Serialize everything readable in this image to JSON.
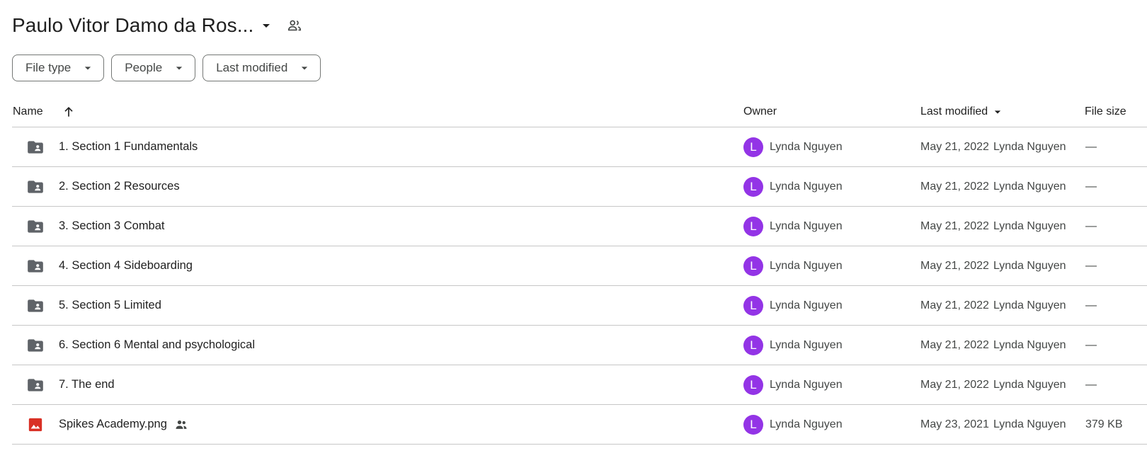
{
  "header": {
    "title": "Paulo Vitor Damo da Ros..."
  },
  "filters": [
    {
      "label": "File type"
    },
    {
      "label": "People"
    },
    {
      "label": "Last modified"
    }
  ],
  "columns": {
    "name": "Name",
    "owner": "Owner",
    "last_modified": "Last modified",
    "file_size": "File size"
  },
  "rows": [
    {
      "type": "folder",
      "name": "1. Section 1 Fundamentals",
      "owner_initial": "L",
      "owner": "Lynda Nguyen",
      "modified_date": "May 21, 2022",
      "modified_by": "Lynda Nguyen",
      "size": "—",
      "shared": false
    },
    {
      "type": "folder",
      "name": "2. Section 2 Resources",
      "owner_initial": "L",
      "owner": "Lynda Nguyen",
      "modified_date": "May 21, 2022",
      "modified_by": "Lynda Nguyen",
      "size": "—",
      "shared": false
    },
    {
      "type": "folder",
      "name": "3. Section 3 Combat",
      "owner_initial": "L",
      "owner": "Lynda Nguyen",
      "modified_date": "May 21, 2022",
      "modified_by": "Lynda Nguyen",
      "size": "—",
      "shared": false
    },
    {
      "type": "folder",
      "name": "4. Section 4 Sideboarding",
      "owner_initial": "L",
      "owner": "Lynda Nguyen",
      "modified_date": "May 21, 2022",
      "modified_by": "Lynda Nguyen",
      "size": "—",
      "shared": false
    },
    {
      "type": "folder",
      "name": "5. Section 5 Limited",
      "owner_initial": "L",
      "owner": "Lynda Nguyen",
      "modified_date": "May 21, 2022",
      "modified_by": "Lynda Nguyen",
      "size": "—",
      "shared": false
    },
    {
      "type": "folder",
      "name": "6. Section 6 Mental and psychological",
      "owner_initial": "L",
      "owner": "Lynda Nguyen",
      "modified_date": "May 21, 2022",
      "modified_by": "Lynda Nguyen",
      "size": "—",
      "shared": false
    },
    {
      "type": "folder",
      "name": "7. The end",
      "owner_initial": "L",
      "owner": "Lynda Nguyen",
      "modified_date": "May 21, 2022",
      "modified_by": "Lynda Nguyen",
      "size": "—",
      "shared": false
    },
    {
      "type": "image",
      "name": "Spikes Academy.png",
      "owner_initial": "L",
      "owner": "Lynda Nguyen",
      "modified_date": "May 23, 2021",
      "modified_by": "Lynda Nguyen",
      "size": "379 KB",
      "shared": true
    }
  ],
  "icons": {
    "title_caret": "arrow-drop-down-icon",
    "title_shared": "people-outline-icon",
    "sort": "arrow-upward-icon",
    "folder": "shared-folder-icon",
    "image": "image-file-icon",
    "shared": "people-icon"
  },
  "colors": {
    "avatar": "#9334e6",
    "folder_icon": "#5f6368",
    "image_icon": "#d93025",
    "divider": "#c7c7c7"
  }
}
